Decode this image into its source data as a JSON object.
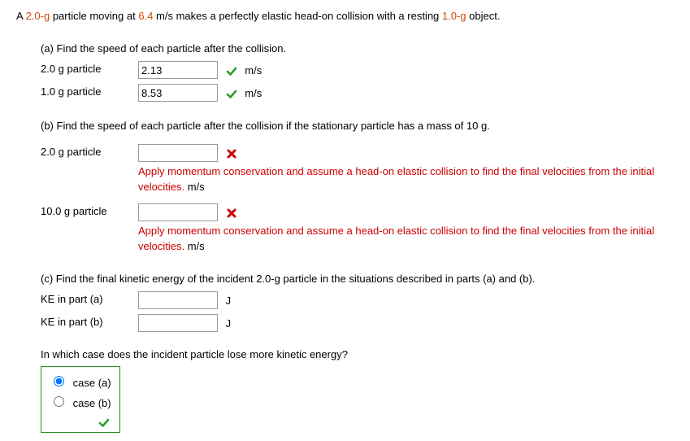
{
  "intro": {
    "pre": "A ",
    "mass1": "2.0-g",
    "mid1": " particle moving at ",
    "speed": "6.4",
    "mid2": " m/s makes a perfectly elastic head-on collision with a resting ",
    "mass2": "1.0-g",
    "post": " object."
  },
  "partA": {
    "prompt": "(a) Find the speed of each particle after the collision.",
    "rows": [
      {
        "label": "2.0 g particle",
        "value": "2.13",
        "unit": "m/s"
      },
      {
        "label": "1.0 g particle",
        "value": "8.53",
        "unit": "m/s"
      }
    ]
  },
  "partB": {
    "prompt": "(b) Find the speed of each particle after the collision if the stationary particle has a mass of 10 g.",
    "rows": [
      {
        "label": "2.0 g particle",
        "value": "",
        "feedback": "Apply momentum conservation and assume a head-on elastic collision to find the final velocities from the initial velocities.",
        "unit": "m/s"
      },
      {
        "label": "10.0 g particle",
        "value": "",
        "feedback": "Apply momentum conservation and assume a head-on elastic collision to find the final velocities from the initial velocities.",
        "unit": "m/s"
      }
    ]
  },
  "partC": {
    "prompt": "(c) Find the final kinetic energy of the incident 2.0-g particle in the situations described in parts (a) and (b).",
    "rows": [
      {
        "label": "KE in part (a)",
        "value": "",
        "unit": "J"
      },
      {
        "label": "KE in part (b)",
        "value": "",
        "unit": "J"
      }
    ],
    "question": "In which case does the incident particle lose more kinetic energy?",
    "options": [
      {
        "label": "case (a)",
        "selected": true
      },
      {
        "label": "case (b)",
        "selected": false
      }
    ]
  }
}
